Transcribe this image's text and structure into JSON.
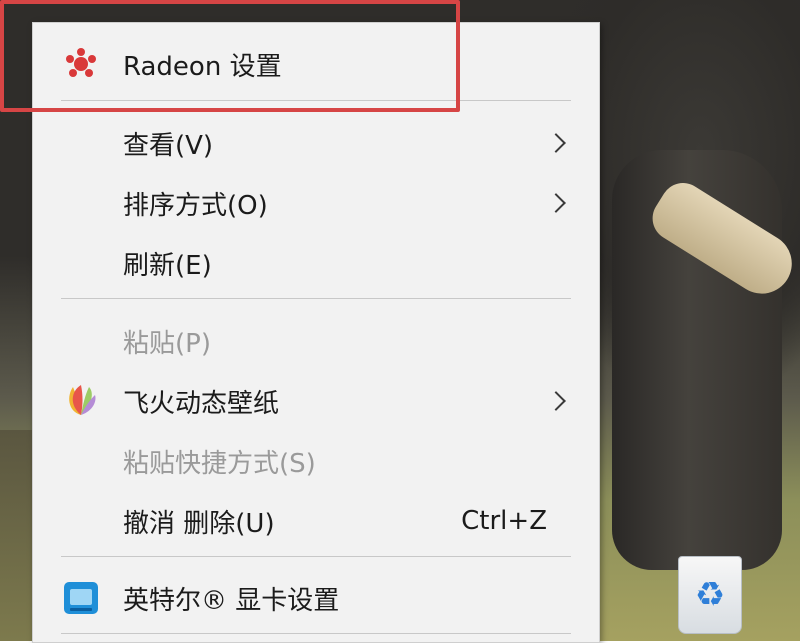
{
  "menu": {
    "items": [
      {
        "label": "Radeon 设置",
        "icon": "radeon-icon"
      },
      {
        "label": "查看(V)",
        "submenu": true
      },
      {
        "label": "排序方式(O)",
        "submenu": true
      },
      {
        "label": "刷新(E)"
      },
      {
        "label": "粘贴(P)",
        "disabled": true
      },
      {
        "label": "飞火动态壁纸",
        "icon": "feihuo-wallpaper-icon",
        "submenu": true
      },
      {
        "label": "粘贴快捷方式(S)",
        "disabled": true
      },
      {
        "label": "撤消 删除(U)",
        "shortcut": "Ctrl+Z"
      },
      {
        "label": "英特尔® 显卡设置",
        "icon": "intel-graphics-icon"
      }
    ]
  },
  "colors": {
    "highlight": "#d64545",
    "radeon": "#d9393a",
    "disabled_text": "#9a9a9a",
    "menu_bg": "#f2f2f2"
  },
  "desktop": {
    "icons": [
      "recycle-bin-icon"
    ]
  }
}
